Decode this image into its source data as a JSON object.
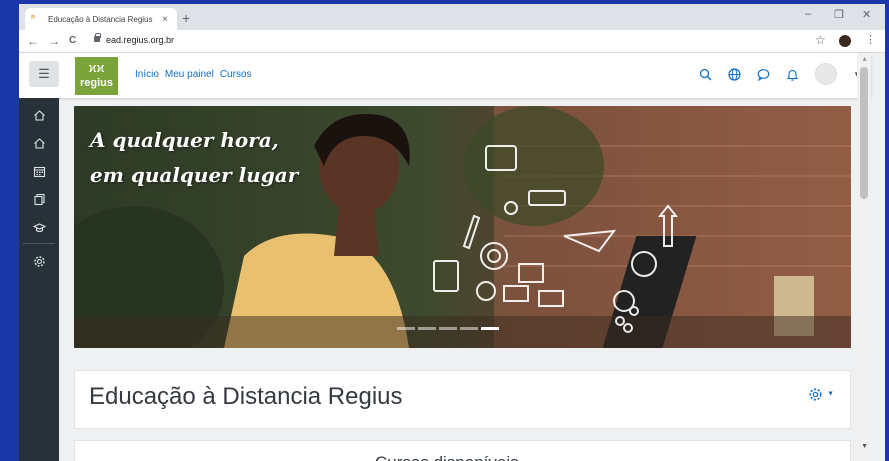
{
  "browser": {
    "tab_title": "Educação à Distancia Regius",
    "tab_close": "×",
    "new_tab": "+",
    "minimize": "–",
    "restore": "❐",
    "close": "✕",
    "back": "←",
    "forward": "→",
    "reload": "C",
    "url": "ead.regius.org.br",
    "bookmark": "☆",
    "menu": "⋮"
  },
  "navbar": {
    "menu_icon": "☰",
    "logo_text": "regius",
    "links": [
      "Início",
      "Meu painel",
      "Cursos"
    ],
    "icons": [
      "search-icon",
      "language-icon",
      "messages-icon",
      "notifications-icon"
    ]
  },
  "sidebar": {
    "items": [
      "home-icon",
      "dashboard-icon",
      "calendar-icon",
      "files-icon",
      "courses-icon",
      "settings-icon"
    ]
  },
  "hero": {
    "line1": "A qualquer hora,",
    "line2": "em qualquer lugar",
    "slides": 5,
    "active_slide": 4
  },
  "main": {
    "site_title": "Educação à Distancia Regius",
    "next_heading": "Cursos disponíveis"
  },
  "colors": {
    "brand_green": "#7aa33a",
    "link_blue": "#0f6fc5",
    "sidebar": "#263238"
  }
}
